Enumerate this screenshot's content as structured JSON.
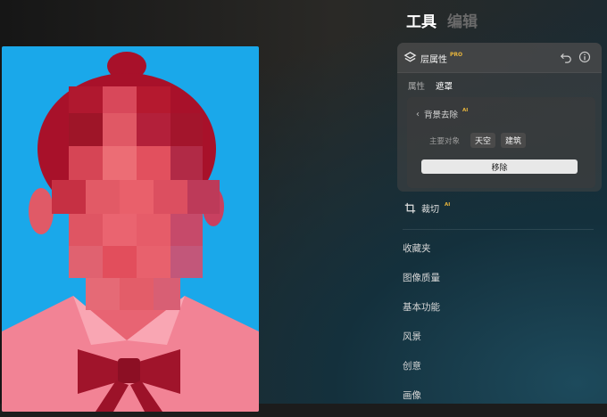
{
  "header": {
    "tabs": [
      {
        "label": "工具",
        "active": true
      },
      {
        "label": "编辑",
        "active": false
      }
    ]
  },
  "layer_card": {
    "title": "层属性",
    "badge": "PRO",
    "subtabs": [
      {
        "label": "属性",
        "active": false
      },
      {
        "label": "遮罩",
        "active": true
      }
    ],
    "bg_removal": {
      "back_label": "背景去除",
      "ai_badge": "AI",
      "subject_label": "主要对象",
      "chips": [
        "天空",
        "建筑"
      ],
      "remove_button": "移除"
    }
  },
  "crop": {
    "label": "裁切",
    "ai_badge": "AI"
  },
  "menu": [
    "收藏夹",
    "图像质量",
    "基本功能",
    "风景",
    "创意",
    "画像"
  ],
  "colors": {
    "photo_background": "#1aa8ea",
    "accent_badge": "#e6b43c"
  },
  "icons": [
    "layers-icon",
    "undo-icon",
    "info-icon",
    "chevron-left-icon",
    "crop-icon"
  ]
}
